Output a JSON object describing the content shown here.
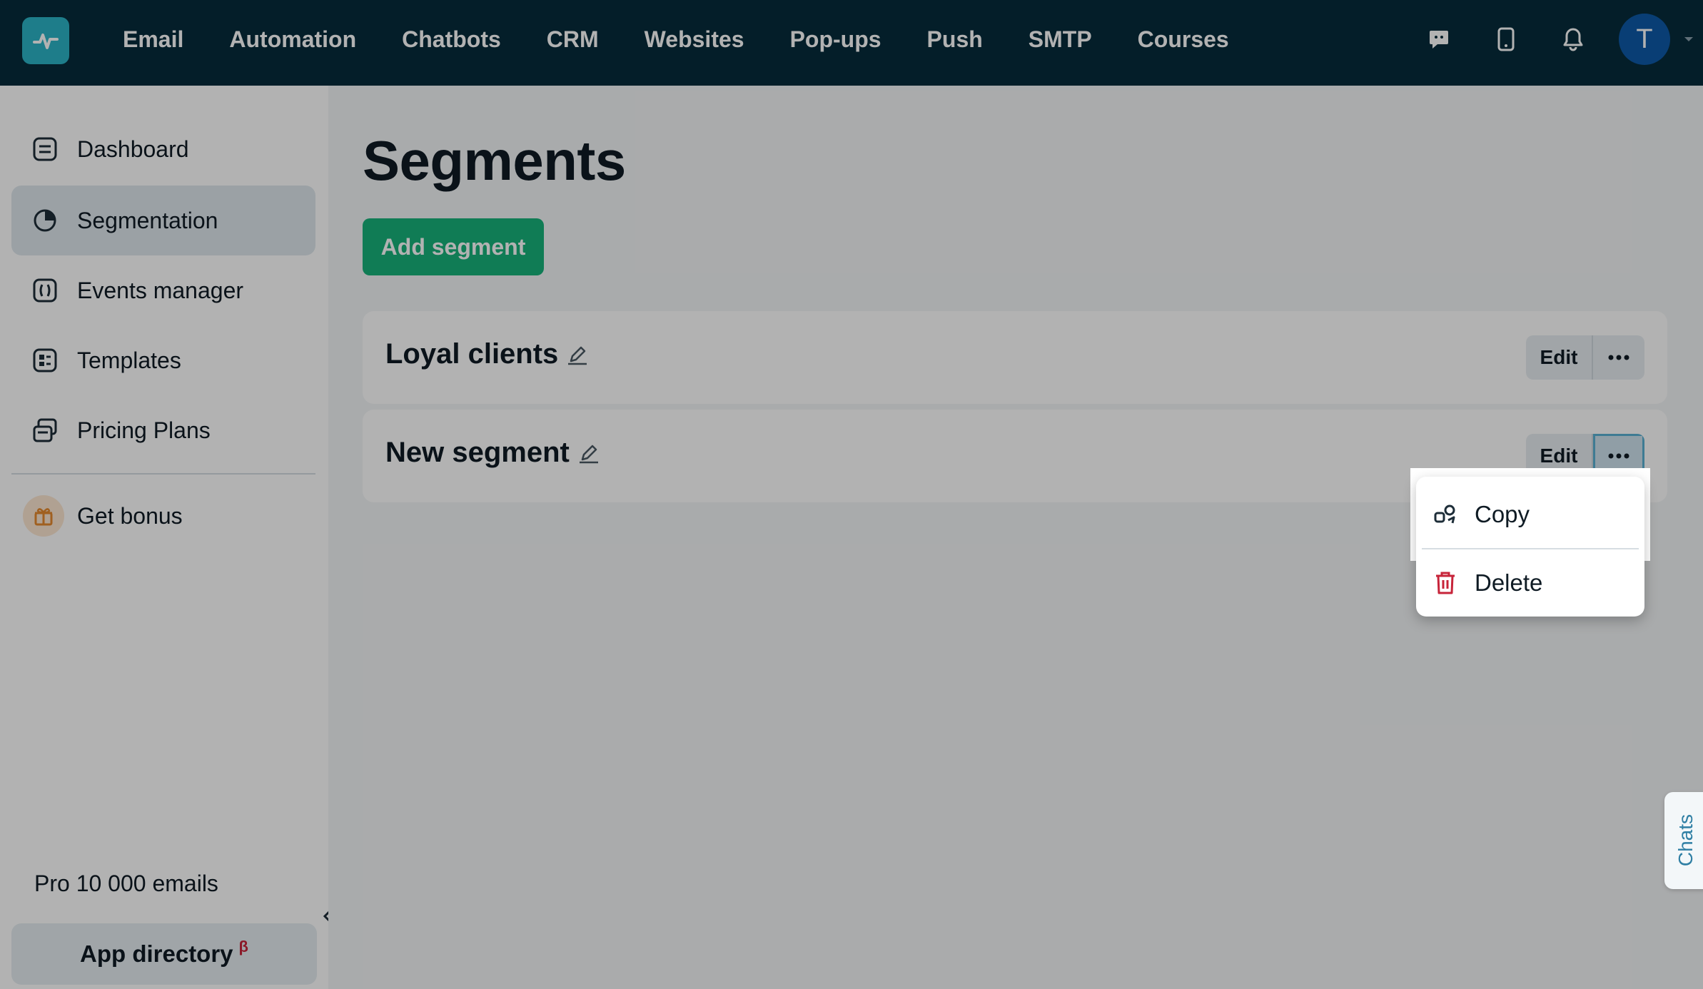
{
  "topnav": {
    "items": [
      "Email",
      "Automation",
      "Chatbots",
      "CRM",
      "Websites",
      "Pop-ups",
      "Push",
      "SMTP",
      "Courses"
    ],
    "avatar_letter": "T"
  },
  "sidebar": {
    "items": [
      {
        "label": "Dashboard",
        "icon": "dashboard-icon"
      },
      {
        "label": "Segmentation",
        "icon": "segmentation-icon"
      },
      {
        "label": "Events manager",
        "icon": "events-icon"
      },
      {
        "label": "Templates",
        "icon": "templates-icon"
      },
      {
        "label": "Pricing Plans",
        "icon": "pricing-icon"
      }
    ],
    "bonus_label": "Get bonus",
    "plan": "Pro 10 000 emails",
    "app_directory": "App directory",
    "beta": "β"
  },
  "main": {
    "title": "Segments",
    "add_button": "Add segment",
    "segments": [
      {
        "name": "Loyal clients",
        "edit_label": "Edit"
      },
      {
        "name": "New segment",
        "edit_label": "Edit"
      }
    ]
  },
  "dropdown": {
    "copy": "Copy",
    "delete": "Delete"
  },
  "chats_tab": "Chats",
  "colors": {
    "topbar": "#062c3b",
    "accent_green": "#17b27a",
    "delete_red": "#c7243a"
  }
}
